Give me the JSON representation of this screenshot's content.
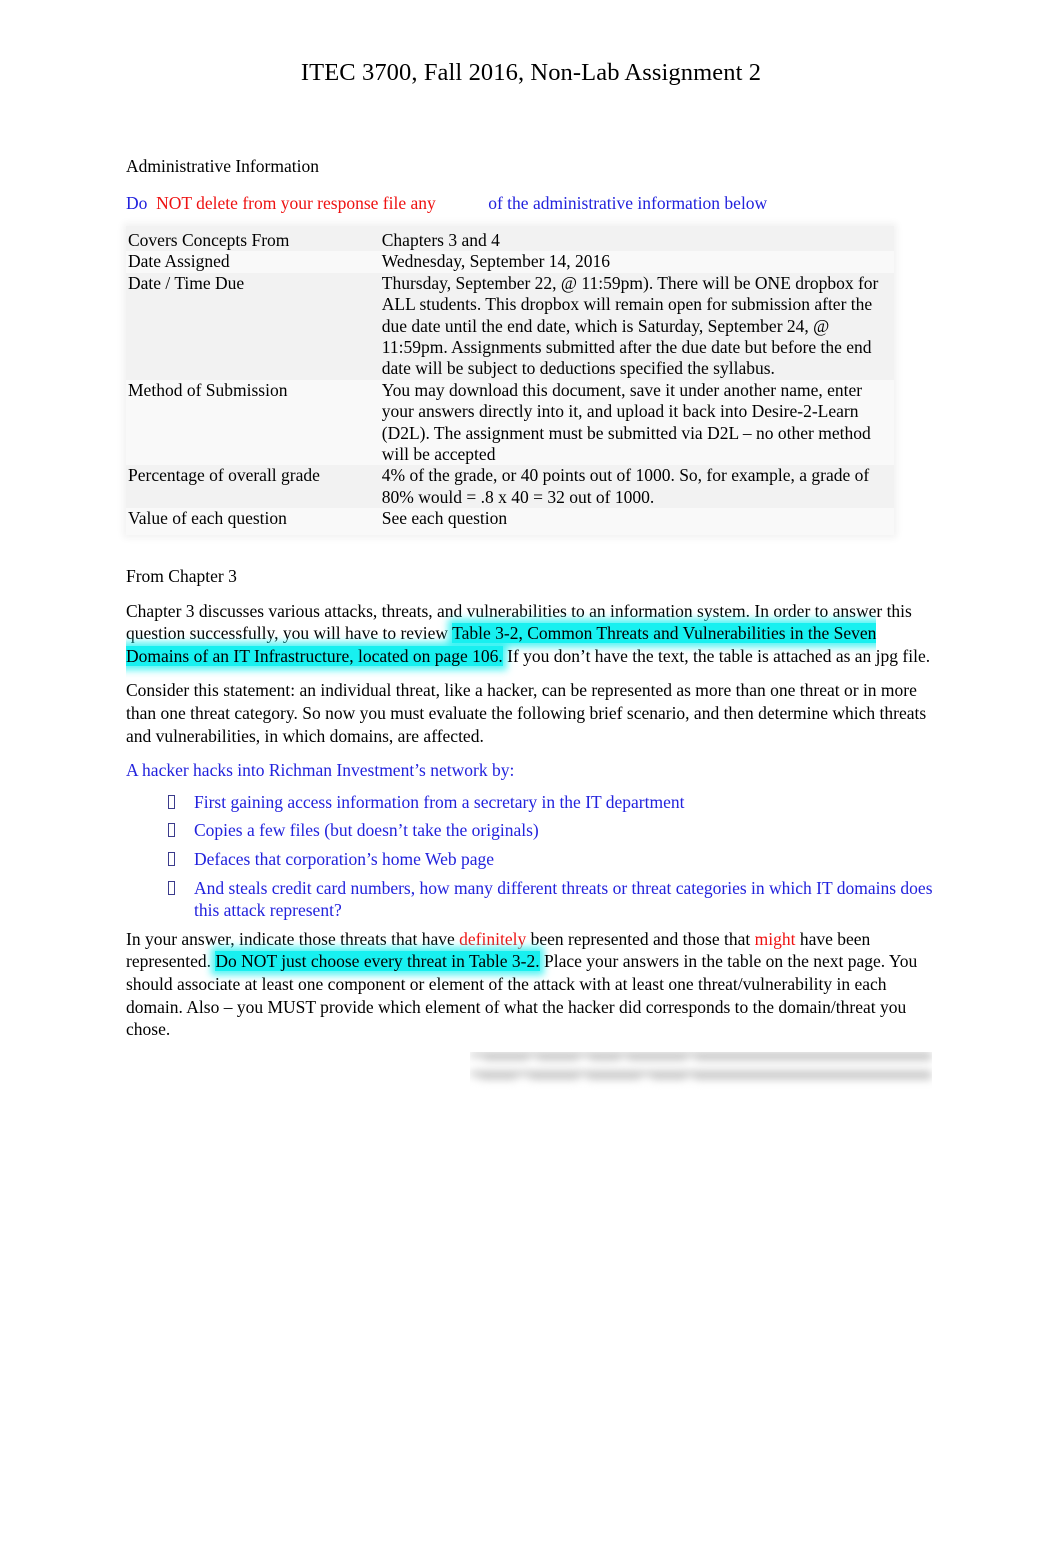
{
  "document": {
    "title": "ITEC 3700, Fall 2016, Non-Lab Assignment 2",
    "section_label": "Administrative Information"
  },
  "notice": {
    "part1_blue": "Do ",
    "part2_red": " NOT delete from your response file any",
    "spacer": "            ",
    "part3_blue": "of the administrative information below"
  },
  "admin_table": {
    "rows": [
      {
        "label": "Covers Concepts From",
        "value": "Chapters 3 and  4"
      },
      {
        "label": "Date Assigned",
        "value": "Wednesday, September 14, 2016"
      },
      {
        "label": "Date / Time Due",
        "value": "Thursday, September 22, @ 11:59pm).    There will be ONE dropbox for  ALL  students.   This dropbox will remain open for submission after the due date until the end date, which is Saturday, September 24, @ 11:59pm.       Assignments submitted after the due date but before the end date will be subject to deductions specified the syllabus."
      },
      {
        "label": "Method of Submission",
        "value": "You may download this document, save it under another name, enter your answers directly into it, and upload it back into Desire-2-Learn (D2L).   The assignment must  be submitted via D2L  – no other method  will be accepted"
      },
      {
        "label": "Percentage of overall grade",
        "value": "4% of the grade, or 40 points out of 1000.   So, for example, a grade of 80% would = .8 x 40 = 32 out of 1000."
      },
      {
        "label": "Value of each question",
        "value": "See each question"
      }
    ]
  },
  "chapter_section": {
    "heading": "From Chapter 3",
    "para1_pre": "Chapter 3 discusses various attacks, threats, and vulnerabilities to an information system.  In order to answer this question successfully, you will have to review ",
    "para1_highlight": "Table 3-2, Common Threats and Vulnerabilities in the Seven Domains of an IT Infrastructure, located on page 106.",
    "para1_post": "  If you don’t have the text, the table is attached as an jpg file.",
    "para2": "Consider this statement: an individual threat, like a hacker, can be represented as more than one threat or in more than one threat category.  So now you must evaluate the following brief scenario, and then determine which threats and vulnerabilities, in which domains, are affected.",
    "scenario_lead": "A hacker hacks into Richman Investment’s network by:",
    "bullets": [
      "First gaining access information from a secretary in the IT department",
      "Copies a few files (but doesn’t take the originals)",
      "Defaces that corporation’s home Web page",
      "And steals credit card numbers, how many different threats or threat categories in which IT domains does this attack represent?"
    ],
    "closing_pre": "In your answer, indicate those threats that have ",
    "closing_red1": "definitely",
    "closing_mid1": "  been represented and those that ",
    "closing_red2": "might",
    "closing_mid2": "  have been represented.  ",
    "closing_highlight": "Do NOT  just choose every threat in Table 3-2.",
    "closing_post": "   Place your answers in the table on the next page.  You should associate at least one component or element of the attack with at least one threat/vulnerability in each  domain. Also – you MUST  provide which element of what the hacker did corresponds to the domain/threat you chose."
  },
  "colors": {
    "blue_text": "#2222dd",
    "red_text": "#ee1111",
    "highlight_cyan": "#18f0f0",
    "table_fill": "#f2f2f2",
    "page_background": "#ffffff"
  },
  "icons": {
    "bullet": "missing-glyph-box"
  }
}
